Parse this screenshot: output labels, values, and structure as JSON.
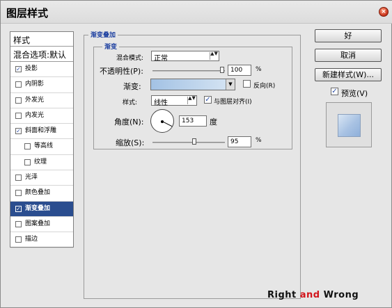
{
  "window": {
    "title": "图层样式",
    "close_glyph": "×"
  },
  "sidebar": {
    "header": "样式",
    "blend_options": "混合选项:默认",
    "items": [
      {
        "label": "投影",
        "checked": true,
        "sub": false,
        "selected": false
      },
      {
        "label": "内阴影",
        "checked": false,
        "sub": false,
        "selected": false
      },
      {
        "label": "外发光",
        "checked": false,
        "sub": false,
        "selected": false
      },
      {
        "label": "内发光",
        "checked": false,
        "sub": false,
        "selected": false
      },
      {
        "label": "斜面和浮雕",
        "checked": true,
        "sub": false,
        "selected": false
      },
      {
        "label": "等高线",
        "checked": false,
        "sub": true,
        "selected": false
      },
      {
        "label": "纹理",
        "checked": false,
        "sub": true,
        "selected": false
      },
      {
        "label": "光泽",
        "checked": false,
        "sub": false,
        "selected": false
      },
      {
        "label": "颜色叠加",
        "checked": false,
        "sub": false,
        "selected": false
      },
      {
        "label": "渐变叠加",
        "checked": true,
        "sub": false,
        "selected": true
      },
      {
        "label": "图案叠加",
        "checked": false,
        "sub": false,
        "selected": false
      },
      {
        "label": "描边",
        "checked": false,
        "sub": false,
        "selected": false
      }
    ]
  },
  "main": {
    "group_title": "渐变叠加",
    "subgroup_title": "渐变",
    "blend_mode": {
      "label": "混合模式:",
      "value": "正常"
    },
    "opacity": {
      "label": "不透明性(P):",
      "value": "100",
      "unit": "%"
    },
    "gradient": {
      "label": "渐变:",
      "colors": [
        "#a3c2e4",
        "#d8e6f4"
      ]
    },
    "reverse": {
      "label": "反向(R)",
      "checked": false
    },
    "style": {
      "label": "样式:",
      "value": "线性"
    },
    "align": {
      "label": "与图层对齐(I)",
      "checked": true
    },
    "angle": {
      "label": "角度(N):",
      "value": "153",
      "unit": "度"
    },
    "scale": {
      "label": "缩放(S):",
      "value": "95",
      "unit": "%"
    }
  },
  "buttons": {
    "ok": "好",
    "cancel": "取消",
    "new_style": "新建样式(W)..."
  },
  "preview": {
    "label": "预览(V)",
    "checked": true
  },
  "watermark": {
    "part1": "Right ",
    "part2": "and",
    "part3": " Wrong"
  },
  "icons": {
    "check": "✓",
    "dropdown": "▲▼",
    "gradient_dropdown": "▼"
  }
}
